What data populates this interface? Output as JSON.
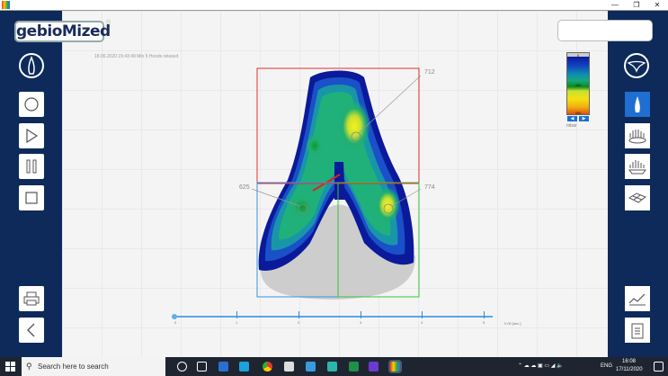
{
  "window": {
    "minimize": "—",
    "maximize": "❐",
    "close": "✕"
  },
  "app": {
    "logo": "gebioMized",
    "registered": "®",
    "timestamp": "18.06.2020 15:43:49 Min 5 Hoods relaxed"
  },
  "legend": {
    "top": "0",
    "mid": "480",
    "bottom": "960",
    "unit": "mbar",
    "prev": "◀",
    "next": "▶"
  },
  "labels": {
    "region_top": "712",
    "region_left": "625",
    "region_right": "774"
  },
  "timeline": {
    "ticks": [
      "0",
      "1",
      "2",
      "3",
      "4",
      "5"
    ],
    "readout": "0.00 [sec.]",
    "position": 0
  },
  "taskbar": {
    "search_placeholder": "Search here to search",
    "lang": "ENG",
    "time": "16:08",
    "date": "17/11/2020"
  },
  "colors": {
    "sidebar": "#0d2a5a",
    "accent": "#1e6fd0",
    "red_box": "#e03030",
    "blue_box": "#3a8ee0",
    "green_box": "#40c040"
  }
}
